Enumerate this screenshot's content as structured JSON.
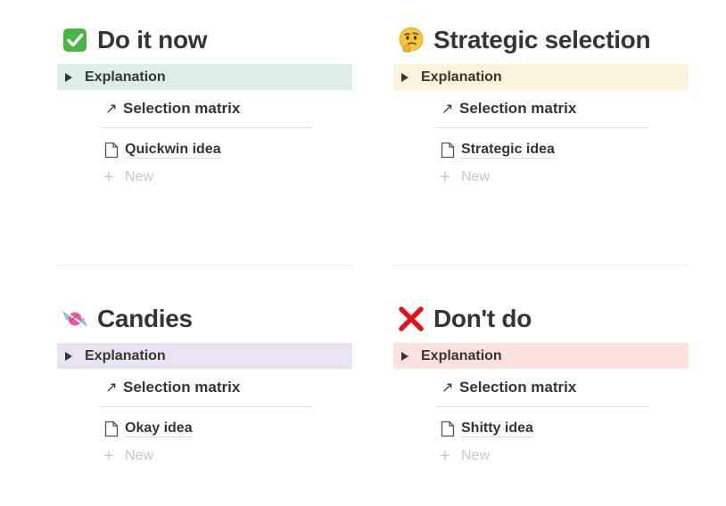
{
  "quadrants": [
    {
      "emoji": "check-mark-button-icon",
      "title": "Do it now",
      "toggle_label": "Explanation",
      "link_label": "Selection matrix",
      "page_label": "Quickwin idea",
      "new_label": "New",
      "accent": "#ddede9"
    },
    {
      "emoji": "thinking-face-icon",
      "title": "Strategic selection",
      "toggle_label": "Explanation",
      "link_label": "Selection matrix",
      "page_label": "Strategic idea",
      "new_label": "New",
      "accent": "#fbf3db"
    },
    {
      "emoji": "candy-icon",
      "title": "Candies",
      "toggle_label": "Explanation",
      "link_label": "Selection matrix",
      "page_label": "Okay idea",
      "new_label": "New",
      "accent": "#eae4f2"
    },
    {
      "emoji": "cross-mark-icon",
      "title": "Don't do",
      "toggle_label": "Explanation",
      "link_label": "Selection matrix",
      "page_label": "Shitty idea",
      "new_label": "New",
      "accent": "#ffe2dd"
    }
  ]
}
